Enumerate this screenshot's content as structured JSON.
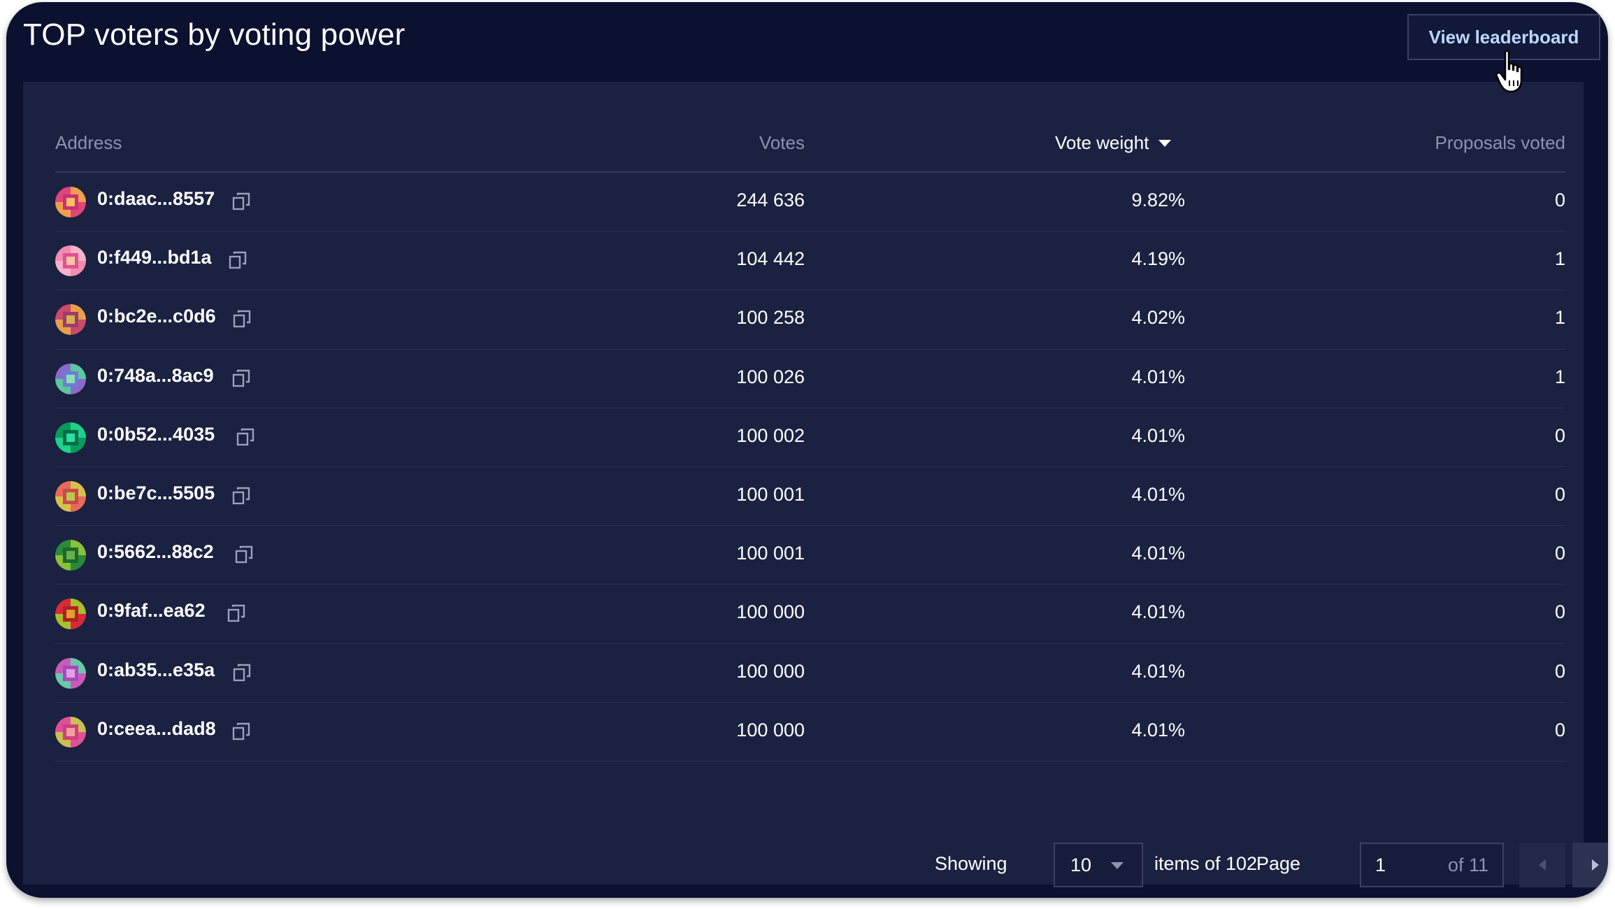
{
  "page": {
    "title": "TOP voters by voting power",
    "view_button_label": "View leaderboard"
  },
  "table": {
    "columns": {
      "address": "Address",
      "votes": "Votes",
      "vote_weight": "Vote weight",
      "proposals_voted": "Proposals voted"
    },
    "sorted_by": "Vote weight",
    "rows": [
      {
        "address": "0:daac...8557",
        "votes": "244 636",
        "vote_weight": "9.82%",
        "proposals_voted": "0",
        "avatar_colors": [
          "#e0457a",
          "#f0a04a",
          "#c9307a",
          "#f6c15a"
        ]
      },
      {
        "address": "0:f449...bd1a",
        "votes": "104 442",
        "vote_weight": "4.19%",
        "proposals_voted": "1",
        "avatar_colors": [
          "#f28ab2",
          "#f6b3c9",
          "#e05094",
          "#fac4a0"
        ]
      },
      {
        "address": "0:bc2e...c0d6",
        "votes": "100 258",
        "vote_weight": "4.02%",
        "proposals_voted": "1",
        "avatar_colors": [
          "#c94a6a",
          "#e6a04c",
          "#9b3c6e",
          "#d9b050"
        ]
      },
      {
        "address": "0:748a...8ac9",
        "votes": "100 026",
        "vote_weight": "4.01%",
        "proposals_voted": "1",
        "avatar_colors": [
          "#8a6ac9",
          "#5cc6a0",
          "#6c7ed8",
          "#8ee0b4"
        ]
      },
      {
        "address": "0:0b52...4035",
        "votes": "100 002",
        "vote_weight": "4.01%",
        "proposals_voted": "0",
        "avatar_colors": [
          "#0a9a5a",
          "#1dd38a",
          "#0b6a4a",
          "#2ae0a0"
        ]
      },
      {
        "address": "0:be7c...5505",
        "votes": "100 001",
        "vote_weight": "4.01%",
        "proposals_voted": "0",
        "avatar_colors": [
          "#e66b5a",
          "#d8c04a",
          "#c94a4a",
          "#b8c850"
        ]
      },
      {
        "address": "0:5662...88c2",
        "votes": "100 001",
        "vote_weight": "4.01%",
        "proposals_voted": "0",
        "avatar_colors": [
          "#2a8a3a",
          "#8ac03a",
          "#1a6a2a",
          "#6ab04a"
        ]
      },
      {
        "address": "0:9faf...ea62",
        "votes": "100 000",
        "vote_weight": "4.01%",
        "proposals_voted": "0",
        "avatar_colors": [
          "#d82a3a",
          "#a8c02a",
          "#b0202a",
          "#e0a030"
        ]
      },
      {
        "address": "0:ab35...e35a",
        "votes": "100 000",
        "vote_weight": "4.01%",
        "proposals_voted": "0",
        "avatar_colors": [
          "#c95ab8",
          "#6ac8a8",
          "#a848c0",
          "#e0a0e0"
        ]
      },
      {
        "address": "0:ceea...dad8",
        "votes": "100 000",
        "vote_weight": "4.01%",
        "proposals_voted": "0",
        "avatar_colors": [
          "#e0509a",
          "#c8c050",
          "#d0407a",
          "#f0a0a0"
        ]
      }
    ]
  },
  "pagination": {
    "showing_label": "Showing",
    "page_size": "10",
    "items_label": "items of 102",
    "page_label": "Page",
    "current_page": "1",
    "of_label": "of 11"
  },
  "colors": {
    "background": "#0c1130",
    "panel": "#1b2140",
    "accent_text": "#bcd8ff",
    "muted_text": "#8c93ad"
  },
  "icons": {
    "copy": "copy-icon",
    "sort": "caret-down-icon",
    "prev": "chevron-left-icon",
    "next": "chevron-right-icon",
    "cursor": "hand-pointer-icon"
  }
}
